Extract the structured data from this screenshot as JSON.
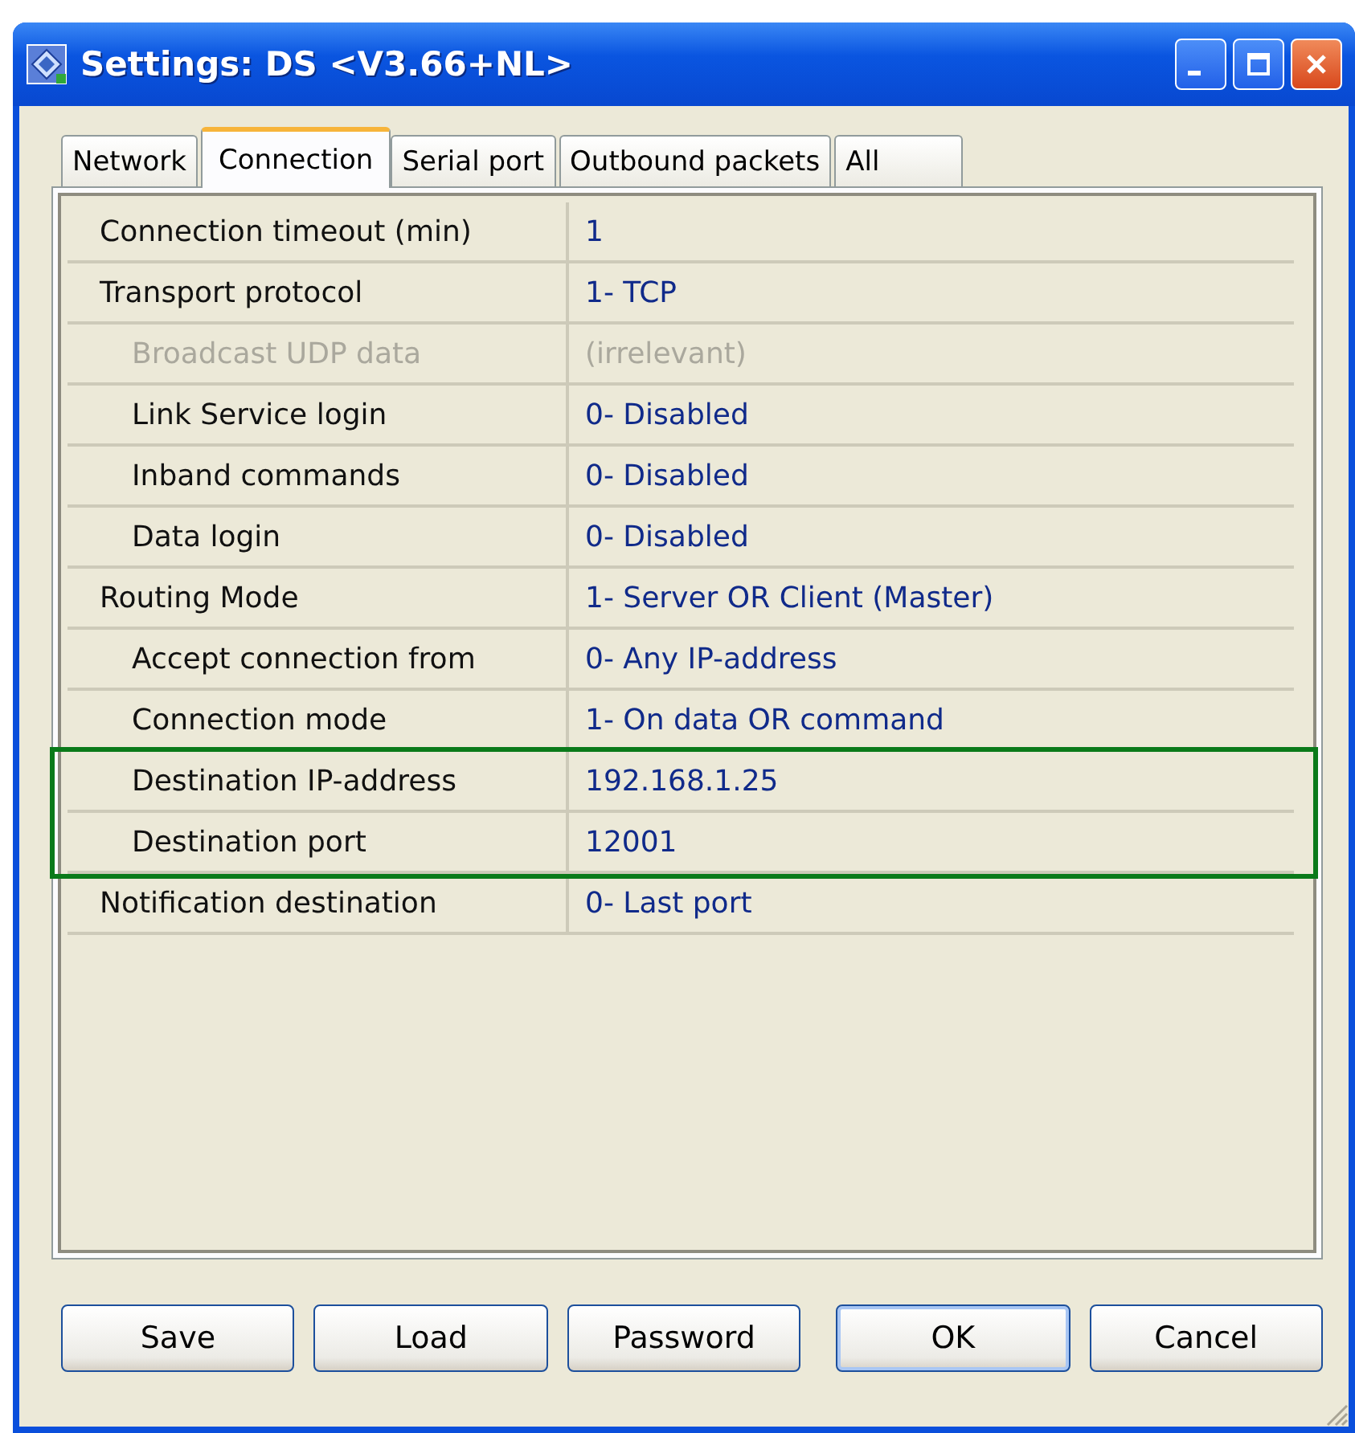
{
  "window": {
    "title": "Settings: DS <V3.66+NL>"
  },
  "tabs": [
    {
      "label": "Network",
      "selected": false
    },
    {
      "label": "Connection",
      "selected": true
    },
    {
      "label": "Serial port",
      "selected": false
    },
    {
      "label": "Outbound packets",
      "selected": false
    },
    {
      "label": "All",
      "selected": false
    }
  ],
  "rows": [
    {
      "name": "Connection timeout (min)",
      "value": "1",
      "disabled": false,
      "highlighted": false
    },
    {
      "name": "Transport protocol",
      "value": "1- TCP",
      "disabled": false,
      "highlighted": false,
      "children": [
        {
          "name": "Broadcast UDP data",
          "value": "(irrelevant)",
          "disabled": true,
          "highlighted": false
        },
        {
          "name": "Link Service login",
          "value": "0- Disabled",
          "disabled": false,
          "highlighted": false
        },
        {
          "name": "Inband commands",
          "value": "0- Disabled",
          "disabled": false,
          "highlighted": false
        },
        {
          "name": "Data login",
          "value": "0- Disabled",
          "disabled": false,
          "highlighted": false
        }
      ]
    },
    {
      "name": "Routing Mode",
      "value": "1- Server OR Client (Master)",
      "disabled": false,
      "highlighted": false,
      "children": [
        {
          "name": "Accept connection from",
          "value": "0- Any IP-address",
          "disabled": false,
          "highlighted": false
        },
        {
          "name": "Connection mode",
          "value": "1- On data OR command",
          "disabled": false,
          "highlighted": false
        },
        {
          "name": "Destination IP-address",
          "value": "192.168.1.25",
          "disabled": false,
          "highlighted": true
        },
        {
          "name": "Destination port",
          "value": "12001",
          "disabled": false,
          "highlighted": true
        }
      ]
    },
    {
      "name": "Notification destination",
      "value": "0- Last port",
      "disabled": false,
      "highlighted": false
    }
  ],
  "buttons": [
    {
      "label": "Save",
      "default": false
    },
    {
      "label": "Load",
      "default": false
    },
    {
      "label": "Password",
      "default": false
    },
    {
      "label": "OK",
      "default": true
    },
    {
      "label": "Cancel",
      "default": false
    }
  ]
}
